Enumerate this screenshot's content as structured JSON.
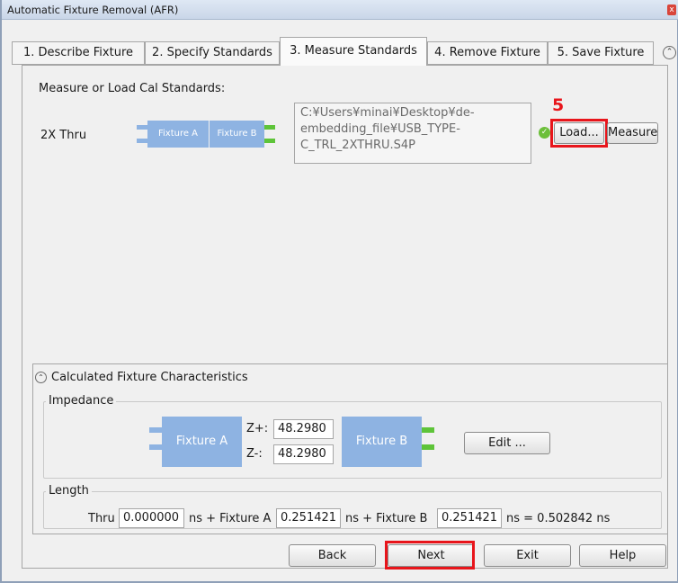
{
  "window": {
    "title": "Automatic Fixture Removal (AFR)",
    "close_icon": "close-icon"
  },
  "tabs": [
    {
      "label": "1. Describe Fixture"
    },
    {
      "label": "2. Specify Standards"
    },
    {
      "label": "3. Measure Standards",
      "active": true
    },
    {
      "label": "4. Remove Fixture"
    },
    {
      "label": "5. Save Fixture"
    }
  ],
  "tab_scroll_icon": "chevron-up-circle-icon",
  "measure_section": {
    "title": "Measure or Load Cal Standards:",
    "standard": {
      "label": "2X Thru",
      "fixture_a": "Fixture A",
      "fixture_b": "Fixture B",
      "file_lines": [
        "C:¥Users¥minai¥Desktop¥de-",
        "embedding_file¥USB_TYPE-",
        "C_TRL_2XTHRU.S4P"
      ],
      "status_icon": "check-circle-icon",
      "load_label": "Load...",
      "measure_label": "Measure"
    },
    "annotation_step": "5"
  },
  "characteristics": {
    "title": "Calculated Fixture Characteristics",
    "impedance": {
      "title": "Impedance",
      "fixture_a": "Fixture A",
      "fixture_b": "Fixture B",
      "z_plus_label": "Z+:",
      "z_plus_value": "48.2980",
      "z_minus_label": "Z-:",
      "z_minus_value": "48.2980",
      "edit_label": "Edit ..."
    },
    "length": {
      "title": "Length",
      "thru_label": "Thru",
      "thru_value": "0.000000",
      "unit1": "ns + Fixture A",
      "fixture_a_value": "0.251421",
      "unit2": "ns + Fixture B",
      "fixture_b_value": "0.251421",
      "total": "ns = 0.502842 ns"
    }
  },
  "footer": {
    "back": "Back",
    "next": "Next",
    "exit": "Exit",
    "help": "Help"
  },
  "colors": {
    "fixture_blue": "#8eb3e2",
    "pin_green": "#5ec439",
    "highlight_red": "#e8151b"
  }
}
